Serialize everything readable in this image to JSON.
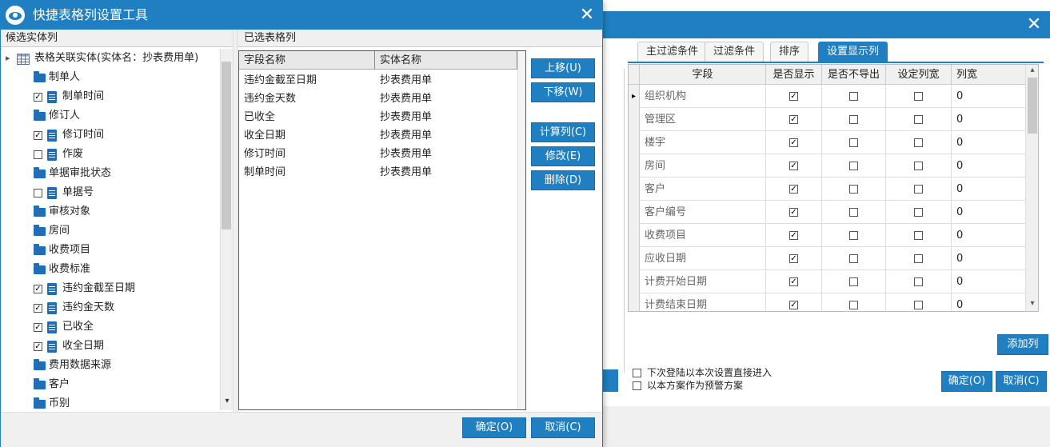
{
  "main_dialog": {
    "title": "快捷表格列设置工具",
    "close_symbol": "✕",
    "left_panel": {
      "header": "候选实体列",
      "root_label": "表格关联实体(实体名：抄表费用单)",
      "items": [
        {
          "label": "制单人",
          "type": "folder"
        },
        {
          "label": "制单时间",
          "type": "field",
          "checked": true
        },
        {
          "label": "修订人",
          "type": "folder"
        },
        {
          "label": "修订时间",
          "type": "field",
          "checked": true
        },
        {
          "label": "作废",
          "type": "field",
          "checked": false
        },
        {
          "label": "单据审批状态",
          "type": "folder"
        },
        {
          "label": "单据号",
          "type": "field",
          "checked": false
        },
        {
          "label": "审核对象",
          "type": "folder"
        },
        {
          "label": "房间",
          "type": "folder"
        },
        {
          "label": "收费项目",
          "type": "folder"
        },
        {
          "label": "收费标准",
          "type": "folder"
        },
        {
          "label": "违约金截至日期",
          "type": "field",
          "checked": true
        },
        {
          "label": "违约金天数",
          "type": "field",
          "checked": true
        },
        {
          "label": "已收全",
          "type": "field",
          "checked": true
        },
        {
          "label": "收全日期",
          "type": "field",
          "checked": true
        },
        {
          "label": "费用数据来源",
          "type": "folder"
        },
        {
          "label": "客户",
          "type": "folder"
        },
        {
          "label": "币别",
          "type": "folder"
        }
      ],
      "expand_symbol": "▸",
      "scroll_down_symbol": "▾",
      "check_symbol": "✓"
    },
    "right_panel": {
      "header": "已选表格列",
      "columns": [
        "字段名称",
        "实体名称"
      ],
      "rows": [
        {
          "field": "违约金截至日期",
          "entity": "抄表费用单"
        },
        {
          "field": "违约金天数",
          "entity": "抄表费用单"
        },
        {
          "field": "已收全",
          "entity": "抄表费用单"
        },
        {
          "field": "收全日期",
          "entity": "抄表费用单"
        },
        {
          "field": "修订时间",
          "entity": "抄表费用单"
        },
        {
          "field": "制单时间",
          "entity": "抄表费用单"
        }
      ]
    },
    "buttons": {
      "move_up": "上移(U)",
      "move_down": "下移(W)",
      "calc_column": "计算列(C)",
      "modify": "修改(E)",
      "delete": "删除(D)",
      "ok": "确定(O)",
      "cancel": "取消(C)"
    }
  },
  "back_window": {
    "close_symbol": "✕",
    "tabs": [
      "主过滤条件",
      "过滤条件",
      "排序",
      "设置显示列"
    ],
    "active_tab": "设置显示列",
    "grid": {
      "columns": [
        "字段",
        "是否显示",
        "是否不导出",
        "设定列宽",
        "列宽"
      ],
      "rows": [
        {
          "field": "组织机构",
          "show": true,
          "no_export": false,
          "set_width": false,
          "width": "0"
        },
        {
          "field": "管理区",
          "show": true,
          "no_export": false,
          "set_width": false,
          "width": "0"
        },
        {
          "field": "楼宇",
          "show": true,
          "no_export": false,
          "set_width": false,
          "width": "0"
        },
        {
          "field": "房间",
          "show": true,
          "no_export": false,
          "set_width": false,
          "width": "0"
        },
        {
          "field": "客户",
          "show": true,
          "no_export": false,
          "set_width": false,
          "width": "0"
        },
        {
          "field": "客户编号",
          "show": true,
          "no_export": false,
          "set_width": false,
          "width": "0"
        },
        {
          "field": "收费项目",
          "show": true,
          "no_export": false,
          "set_width": false,
          "width": "0"
        },
        {
          "field": "应收日期",
          "show": true,
          "no_export": false,
          "set_width": false,
          "width": "0"
        },
        {
          "field": "计费开始日期",
          "show": true,
          "no_export": false,
          "set_width": false,
          "width": "0"
        },
        {
          "field": "计费结束日期",
          "show": true,
          "no_export": false,
          "set_width": false,
          "width": "0"
        }
      ],
      "current_row_marker": "▸",
      "scroll_up_symbol": "▴",
      "scroll_down_symbol": "▾"
    },
    "add_column_button": "添加列",
    "option_direct_enter": "下次登陆以本次设置直接进入",
    "option_alert_scheme": "以本方案作为预警方案",
    "ok_button": "确定(O)",
    "cancel_button": "取消(C)"
  },
  "colors": {
    "accent": "#1f7fc1",
    "folder_icon": "#1f6fb8"
  }
}
